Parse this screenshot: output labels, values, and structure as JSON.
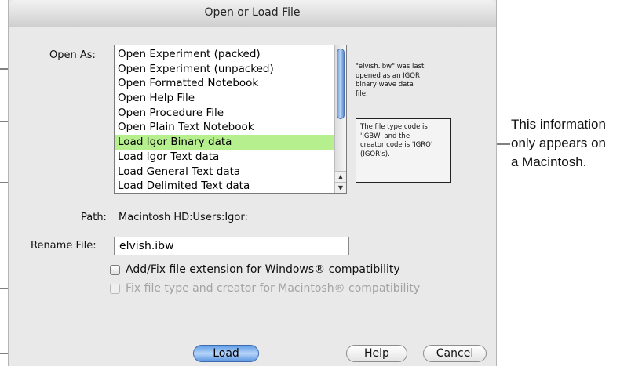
{
  "dialog": {
    "title": "Open or Load File",
    "open_as_label": "Open As:",
    "list_items": [
      "Open Experiment (packed)",
      "Open Experiment (unpacked)",
      "Open Formatted Notebook",
      "Open Help File",
      "Open Procedure File",
      "Open Plain Text Notebook",
      "Load Igor Binary data",
      "Load Igor Text data",
      "Load General Text data",
      "Load Delimited Text data"
    ],
    "selected_item": "Load Igor Binary data",
    "file_info": "\"elvish.ibw\" was last\nopened as an IGOR\nbinary wave data\nfile.",
    "type_creator_info": "The file type code is\n'IGBW' and the\ncreator code is 'IGRO'\n(IGOR's).",
    "path_label": "Path:",
    "path_value": "Macintosh HD:Users:Igor:",
    "rename_label": "Rename File:",
    "rename_value": "elvish.ibw",
    "checkbox_windows": {
      "label": "Add/Fix file extension for Windows® compatibility",
      "checked": false,
      "enabled": true
    },
    "checkbox_mac": {
      "label": "Fix file type and creator for Macintosh® compatibility",
      "checked": false,
      "enabled": false
    },
    "buttons": {
      "load": "Load",
      "help": "Help",
      "cancel": "Cancel"
    }
  },
  "annotation": {
    "side_note_lines": [
      "This information",
      "only appears on",
      "a Macintosh."
    ]
  },
  "colors": {
    "selected_row": "#b6ef8d",
    "default_button": "#7fb0ee",
    "dialog_bg": "#e9e9e9"
  }
}
